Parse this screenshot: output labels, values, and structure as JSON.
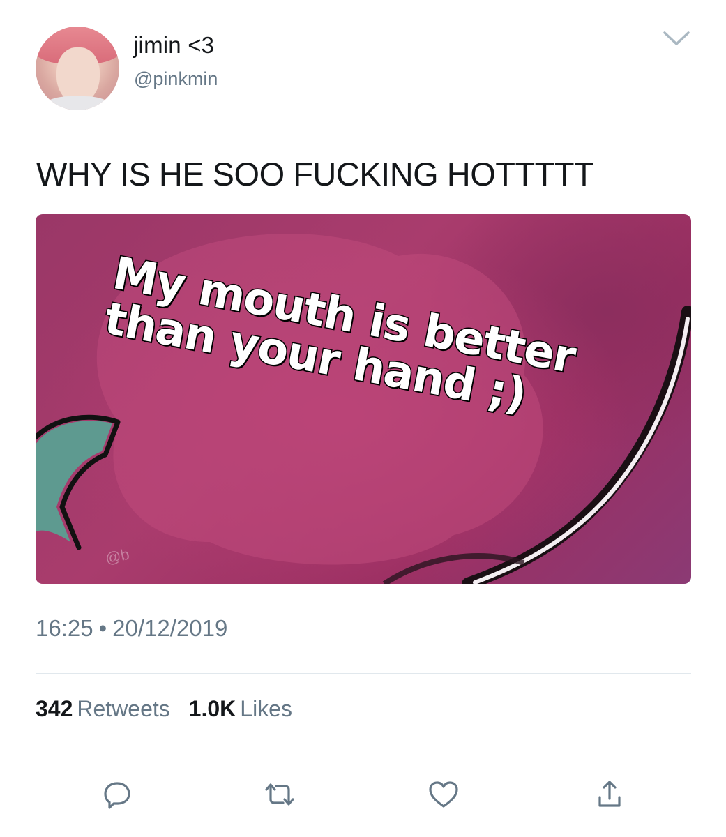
{
  "user": {
    "display_name": "jimin <3",
    "handle": "@pinkmin"
  },
  "tweet": {
    "text": "WHY IS HE SOO FUCKING HOTTTTT",
    "time": "16:25",
    "separator": "•",
    "date": "20/12/2019"
  },
  "media": {
    "meme_lines": [
      "My mouth is better",
      "than your hand ;)"
    ],
    "watermark": "@b"
  },
  "stats": {
    "retweets_count": "342",
    "retweets_label": "Retweets",
    "likes_count": "1.0K",
    "likes_label": "Likes"
  },
  "icons": {
    "menu": "chevron-down-icon",
    "reply": "reply-icon",
    "retweet": "retweet-icon",
    "like": "heart-icon",
    "share": "share-icon"
  },
  "colors": {
    "text_primary": "#14171a",
    "text_secondary": "#657786",
    "divider": "#e1e8ed",
    "media_background": "#a93c6d"
  }
}
